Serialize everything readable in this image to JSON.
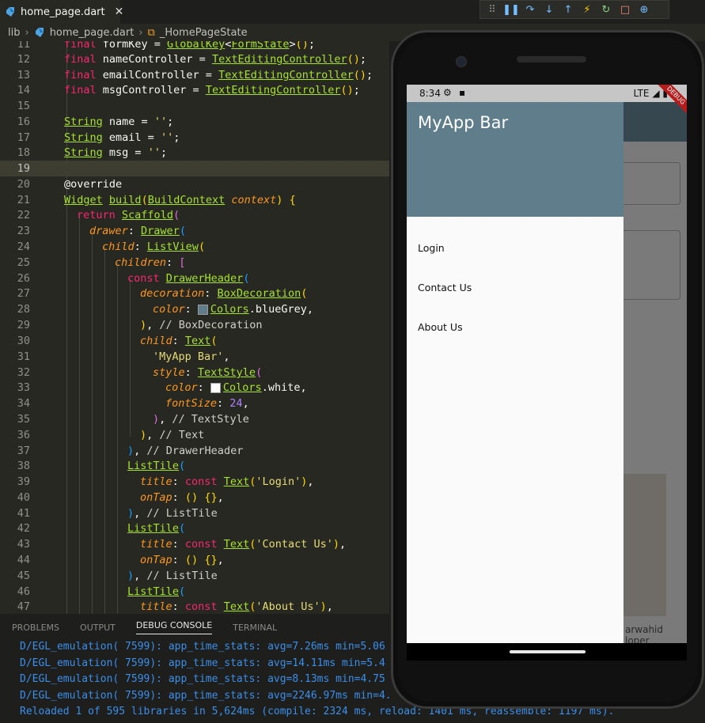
{
  "tab": {
    "filename": "home_page.dart",
    "close": "✕"
  },
  "breadcrumb": {
    "root": "lib",
    "file": "home_page.dart",
    "symbol": "_HomePageState"
  },
  "code_lines": [
    {
      "n": "11",
      "text": "final formKey = GlobalKey<FormState>();"
    },
    {
      "n": "12",
      "text": "final nameController = TextEditingController();"
    },
    {
      "n": "13",
      "text": "final emailController = TextEditingController();"
    },
    {
      "n": "14",
      "text": "final msgController = TextEditingController();"
    },
    {
      "n": "15",
      "text": ""
    },
    {
      "n": "16",
      "text": "String name = '';"
    },
    {
      "n": "17",
      "text": "String email = '';"
    },
    {
      "n": "18",
      "text": "String msg = '';"
    },
    {
      "n": "19",
      "text": ""
    },
    {
      "n": "20",
      "text": "@override"
    },
    {
      "n": "21",
      "text": "Widget build(BuildContext context) {"
    },
    {
      "n": "22",
      "text": "return Scaffold("
    },
    {
      "n": "23",
      "text": "drawer: Drawer("
    },
    {
      "n": "24",
      "text": "child: ListView("
    },
    {
      "n": "25",
      "text": "children: ["
    },
    {
      "n": "26",
      "text": "const DrawerHeader("
    },
    {
      "n": "27",
      "text": "decoration: BoxDecoration("
    },
    {
      "n": "28",
      "text": "color: Colors.blueGrey,"
    },
    {
      "n": "29",
      "text": "), // BoxDecoration"
    },
    {
      "n": "30",
      "text": "child: Text("
    },
    {
      "n": "31",
      "text": "'MyApp Bar',"
    },
    {
      "n": "32",
      "text": "style: TextStyle("
    },
    {
      "n": "33",
      "text": "color: Colors.white,"
    },
    {
      "n": "34",
      "text": "fontSize: 24,"
    },
    {
      "n": "35",
      "text": "), // TextStyle"
    },
    {
      "n": "36",
      "text": "), // Text"
    },
    {
      "n": "37",
      "text": "), // DrawerHeader"
    },
    {
      "n": "38",
      "text": "ListTile("
    },
    {
      "n": "39",
      "text": "title: const Text('Login'),"
    },
    {
      "n": "40",
      "text": "onTap: () {},"
    },
    {
      "n": "41",
      "text": "), // ListTile"
    },
    {
      "n": "42",
      "text": "ListTile("
    },
    {
      "n": "43",
      "text": "title: const Text('Contact Us'),"
    },
    {
      "n": "44",
      "text": "onTap: () {},"
    },
    {
      "n": "45",
      "text": "), // ListTile"
    },
    {
      "n": "46",
      "text": "ListTile("
    },
    {
      "n": "47",
      "text": "title: const Text('About Us'),"
    }
  ],
  "panel": {
    "tabs": [
      "PROBLEMS",
      "OUTPUT",
      "DEBUG CONSOLE",
      "TERMINAL"
    ],
    "active": "DEBUG CONSOLE"
  },
  "console_lines": [
    "D/EGL_emulation( 7599): app_time_stats: avg=7.26ms min=5.06",
    "D/EGL_emulation( 7599): app_time_stats: avg=14.11ms min=5.4",
    "D/EGL_emulation( 7599): app_time_stats: avg=8.13ms min=4.75",
    "D/EGL_emulation( 7599): app_time_stats: avg=2246.97ms min=4.",
    "Reloaded 1 of 595 libraries in 5,624ms (compile: 2324 ms, reload: 1401 ms, reassemble: 1197 ms)."
  ],
  "phone": {
    "status_time": "8:34",
    "status_network": "LTE",
    "debug_banner": "DEBUG",
    "drawer_title": "MyApp Bar",
    "drawer_items": [
      "Login",
      "Contact Us",
      "About Us"
    ],
    "bg_text_line1": "arwahid",
    "bg_text_line2": "loper"
  },
  "colors": {
    "drawer_header": "#607d8b",
    "editor_bg": "#272822",
    "keyword": "#f92672",
    "type": "#a6e22e",
    "string": "#e6db74",
    "console": "#3b8eea"
  }
}
